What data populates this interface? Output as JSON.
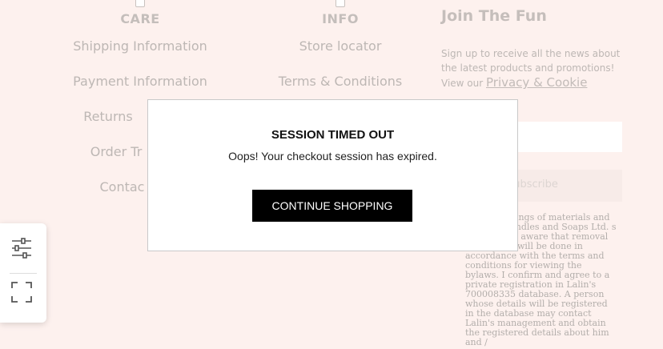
{
  "footer": {
    "care": {
      "title": "CARE",
      "links": [
        "Shipping Information",
        "Payment Information",
        "Returns",
        "Order Tr",
        "Contac"
      ]
    },
    "info": {
      "title": "INFO",
      "links": [
        "Store locator",
        "Terms & Conditions"
      ]
    },
    "join": {
      "title": "Join The Fun",
      "text": "Sign up to receive all the news about the latest products and promotions!",
      "view_prefix": "View our ",
      "policy_link": "Privacy & Cookie",
      "email_placeholder": "s",
      "subscribe_label": "Subscribe",
      "consent": "eceive mailings of materials and updates Candles and Soaps Ltd. s media. I am aware that removal of mailings will be done in accordance with the terms and conditions for viewing the bylaws. I confirm and agree to a private registration in Lalin's 700008335 database. A person whose details will be registered in the database may contact Lalin's management and obtain the registered details about him and /"
    }
  },
  "modal": {
    "title": "SESSION TIMED OUT",
    "message": "Oops! Your checkout session has expired.",
    "button_label": "CONTINUE SHOPPING"
  },
  "sidebar": {
    "icons": [
      "sliders-icon",
      "fullscreen-icon"
    ]
  }
}
